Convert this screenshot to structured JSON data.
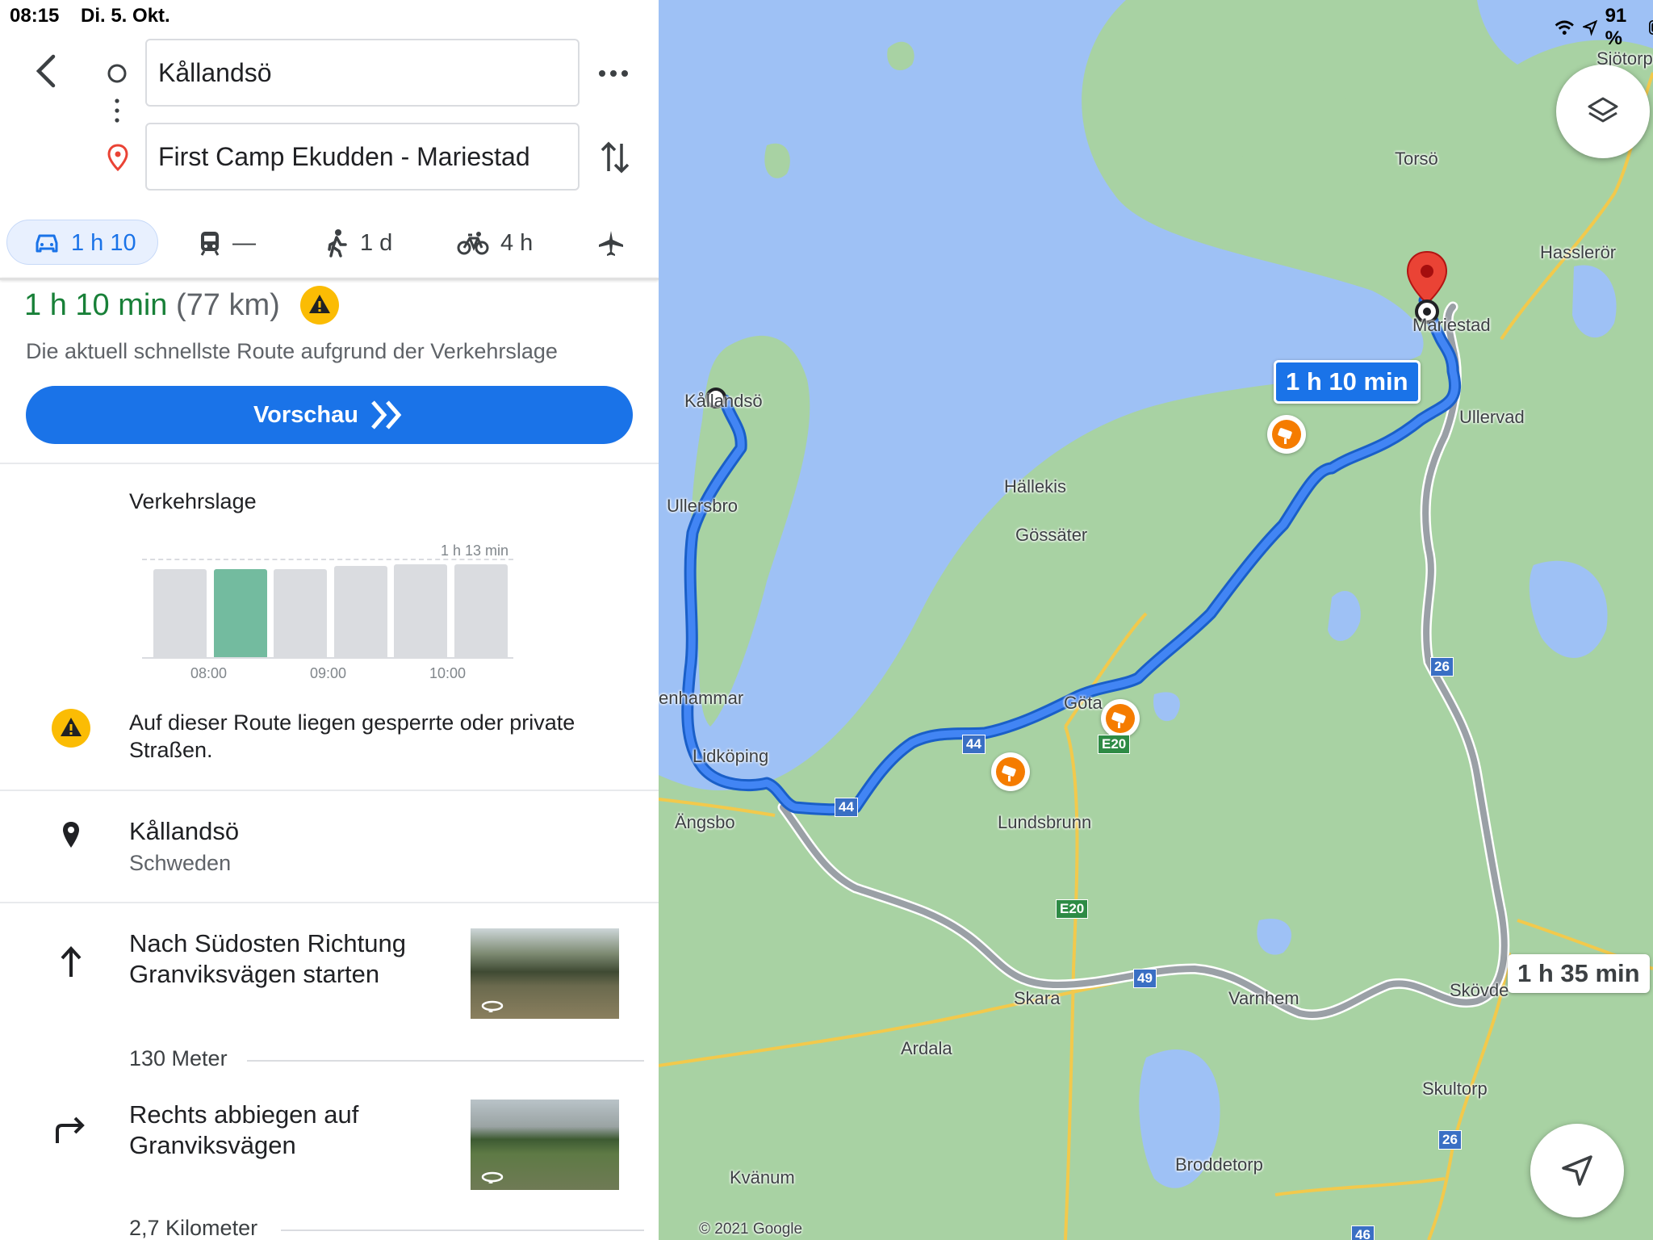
{
  "status_bar": {
    "time": "08:15",
    "date": "Di. 5. Okt.",
    "battery": "91 %"
  },
  "search": {
    "origin": "Kållandsö",
    "destination": "First Camp Ekudden - Mariestad"
  },
  "modes": {
    "car": "1 h 10",
    "transit": "—",
    "walk": "1 d",
    "bike": "4 h"
  },
  "route": {
    "duration": "1 h 10 min",
    "distance": "(77 km)",
    "description": "Die aktuell schnellste Route aufgrund der Verkehrslage",
    "preview_button": "Vorschau"
  },
  "traffic": {
    "title": "Verkehrslage",
    "max_label": "1 h 13 min",
    "ticks": [
      "08:00",
      "09:00",
      "10:00"
    ],
    "bars": [
      0.88,
      0.88,
      0.88,
      0.91,
      0.93,
      0.93
    ],
    "current_index": 1,
    "colors": {
      "bar": "#dadce0",
      "current": "#73bb9f"
    }
  },
  "warning": {
    "text": "Auf dieser Route liegen gesperrte oder private Straßen."
  },
  "start": {
    "name": "Kållandsö",
    "country": "Schweden"
  },
  "steps": [
    {
      "instruction": "Nach Südosten Richtung Granviksvägen starten",
      "distance": "130 Meter",
      "icon": "arrow-up-icon"
    },
    {
      "instruction": "Rechts abbiegen auf Granviksvägen",
      "distance": "2,7 Kilometer",
      "icon": "turn-right-icon"
    }
  ],
  "map": {
    "route_label": "1 h 10 min",
    "alt_route_label": "1 h 35 min",
    "copyright": "© 2021 Google",
    "places": [
      {
        "id": "sjotorp",
        "name": "Sjötorp"
      },
      {
        "id": "torso",
        "name": "Torsö"
      },
      {
        "id": "hasslero",
        "name": "Hasslerör"
      },
      {
        "id": "mariestad",
        "name": "Mariestad"
      },
      {
        "id": "ullervad",
        "name": "Ullervad"
      },
      {
        "id": "kallandso",
        "name": "Kållandsö"
      },
      {
        "id": "hallekis",
        "name": "Hällekis"
      },
      {
        "id": "gossater",
        "name": "Gössäter"
      },
      {
        "id": "ullersbro",
        "name": "Ullersbro"
      },
      {
        "id": "enhammar",
        "name": "enhammar"
      },
      {
        "id": "lidkoping",
        "name": "Lidköping"
      },
      {
        "id": "gota",
        "name": "Göta"
      },
      {
        "id": "angsbo",
        "name": "Ängsbo"
      },
      {
        "id": "lundsbrunn",
        "name": "Lundsbrunn"
      },
      {
        "id": "skara",
        "name": "Skara"
      },
      {
        "id": "varnhem",
        "name": "Varnhem"
      },
      {
        "id": "skovde",
        "name": "Skövde"
      },
      {
        "id": "ardala",
        "name": "Ardala"
      },
      {
        "id": "skultorp",
        "name": "Skultorp"
      },
      {
        "id": "broddetorp",
        "name": "Broddetorp"
      },
      {
        "id": "kvanum",
        "name": "Kvänum"
      }
    ],
    "road_shields": {
      "r44": "44",
      "e20": "E20",
      "r49": "49",
      "r26": "26",
      "r46": "46"
    }
  },
  "colors": {
    "route": "#4285f4",
    "route_dark": "#1a73e8",
    "duration": "#188038",
    "water": "#9ec1f5",
    "land": "#a8d2a3"
  }
}
